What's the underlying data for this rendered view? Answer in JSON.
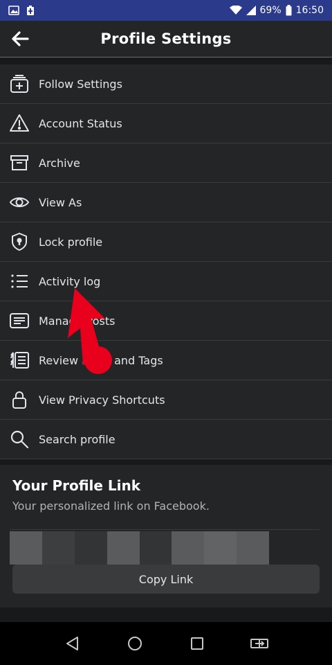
{
  "status_bar": {
    "battery": "69%",
    "time": "16:50"
  },
  "app_bar": {
    "title": "Profile Settings"
  },
  "menu": {
    "items": [
      {
        "label": "Follow Settings",
        "icon": "follow-settings-icon"
      },
      {
        "label": "Account Status",
        "icon": "warning-icon"
      },
      {
        "label": "Archive",
        "icon": "archive-icon"
      },
      {
        "label": "View As",
        "icon": "eye-icon"
      },
      {
        "label": "Lock profile",
        "icon": "shield-lock-icon"
      },
      {
        "label": "Activity log",
        "icon": "list-icon"
      },
      {
        "label": "Manage Posts",
        "icon": "posts-icon"
      },
      {
        "label": "Review Posts and Tags",
        "icon": "review-tags-icon"
      },
      {
        "label": "View Privacy Shortcuts",
        "icon": "lock-icon"
      },
      {
        "label": "Search profile",
        "icon": "search-icon"
      }
    ]
  },
  "profile_link": {
    "title": "Your Profile Link",
    "subtitle": "Your personalized link on Facebook.",
    "copy_label": "Copy Link"
  },
  "colors": {
    "status_bar": "#2b3a8a",
    "surface": "#242526",
    "background": "#18191a",
    "annotation": "#e8001c"
  }
}
